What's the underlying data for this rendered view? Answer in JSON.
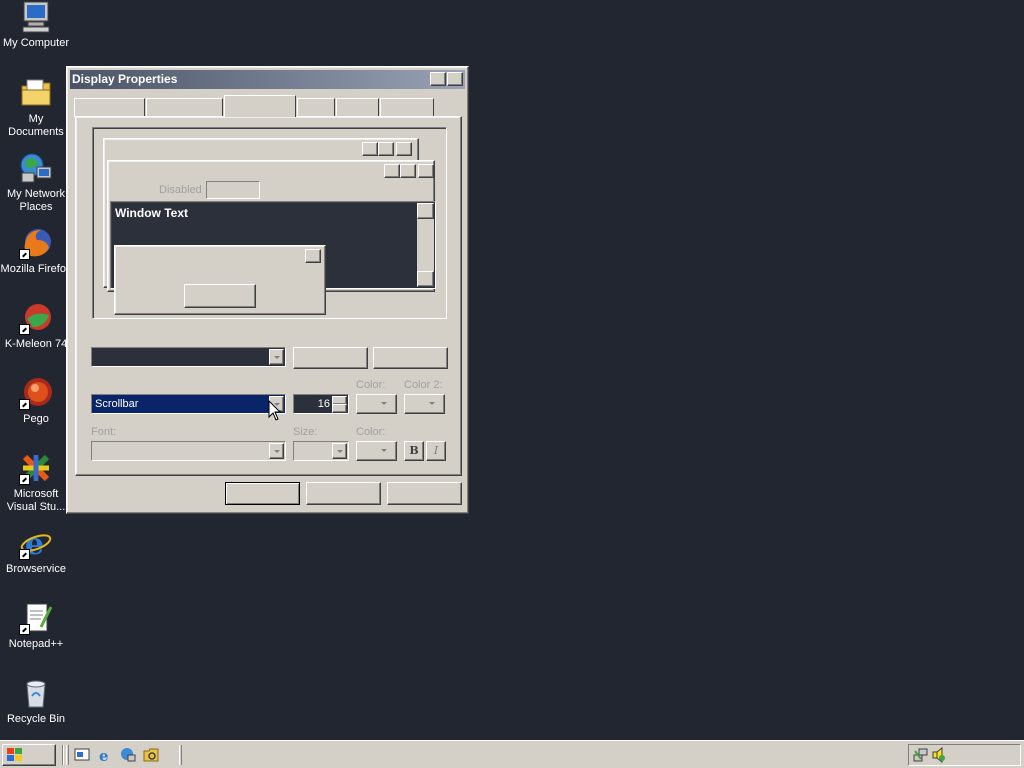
{
  "desktop": {
    "background_color": "#222630",
    "icons": [
      {
        "label": "My Computer",
        "icon": "my-computer-icon",
        "shortcut": false
      },
      {
        "label": "My Documents",
        "icon": "folder-icon",
        "shortcut": false
      },
      {
        "label": "My Network\nPlaces",
        "icon": "network-places-icon",
        "shortcut": false
      },
      {
        "label": "Mozilla Firefox",
        "icon": "firefox-icon",
        "shortcut": true
      },
      {
        "label": "K-Meleon 74",
        "icon": "k-meleon-icon",
        "shortcut": true
      },
      {
        "label": "Pego",
        "icon": "pego-icon",
        "shortcut": true
      },
      {
        "label": "Microsoft\nVisual Stu...",
        "icon": "visual-studio-icon",
        "shortcut": true
      },
      {
        "label": "Browservice",
        "icon": "internet-explorer-icon",
        "shortcut": true
      },
      {
        "label": "Notepad++",
        "icon": "notepad-plus-plus-icon",
        "shortcut": true
      },
      {
        "label": "Recycle Bin",
        "icon": "recycle-bin-icon",
        "shortcut": false
      }
    ]
  },
  "dialog": {
    "title": "Display Properties",
    "preview": {
      "disabled_label": "Disabled",
      "window_text": "Window Text"
    },
    "item": {
      "label": "",
      "selected_value": "Scrollbar",
      "size_value": "16",
      "color_label": "Color:",
      "color2_label": "Color 2:"
    },
    "font": {
      "font_label": "Font:",
      "size_label": "Size:",
      "color_label": "Color:",
      "bold_label": "B",
      "italic_label": "I"
    }
  },
  "taskbar": {
    "quick_launch": [
      "show-desktop-icon",
      "internet-explorer-icon",
      "network-icon",
      "explorer-icon"
    ]
  },
  "colors": {
    "title_start": "#4a5466",
    "title_end": "#98a2b4",
    "selection": "#0a246a",
    "face": "#d4d0c8",
    "preview_window_bg": "#2c303a"
  }
}
